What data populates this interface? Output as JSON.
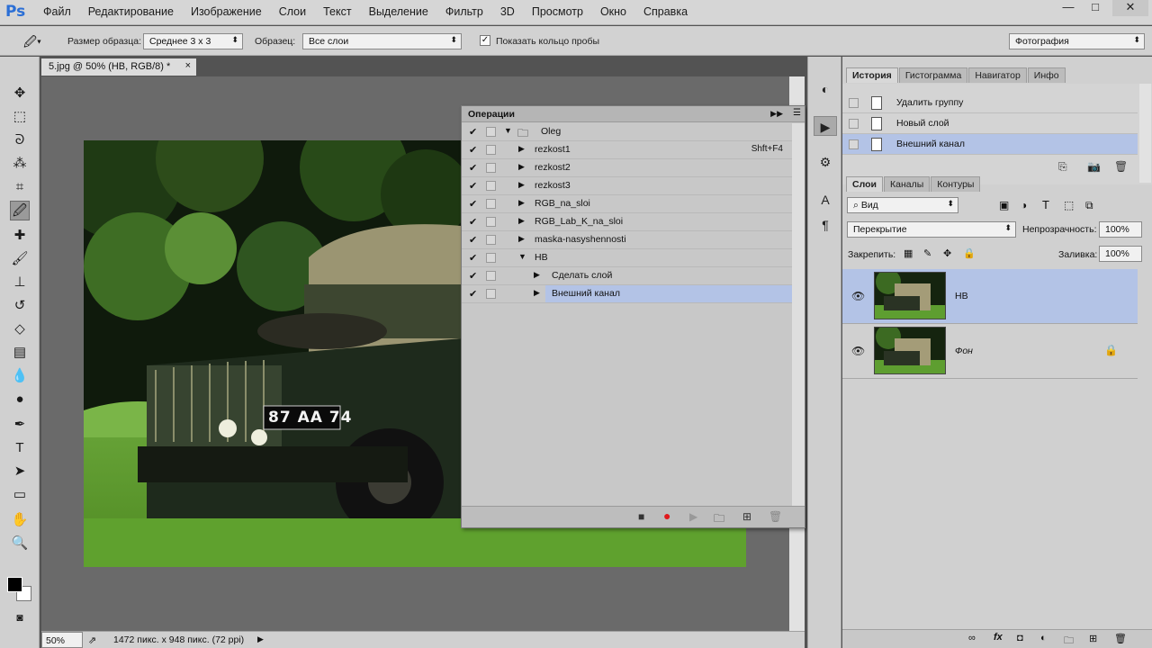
{
  "app": {
    "logo": "Ps"
  },
  "menu": [
    "Файл",
    "Редактирование",
    "Изображение",
    "Слои",
    "Текст",
    "Выделение",
    "Фильтр",
    "3D",
    "Просмотр",
    "Окно",
    "Справка"
  ],
  "window_controls": {
    "minimize": "—",
    "maximize": "□",
    "close": "✕"
  },
  "options": {
    "sample_size_label": "Размер образца:",
    "sample_size_value": "Среднее 3 x 3",
    "sample_label": "Образец:",
    "sample_value": "Все слои",
    "show_ring_label": "Показать кольцо пробы",
    "show_ring_checked": true,
    "workspace": "Фотография"
  },
  "tools": [
    "move-icon",
    "marquee-icon",
    "lasso-icon",
    "quick-select-icon",
    "crop-icon",
    "eyedropper-icon",
    "healing-icon",
    "brush-icon",
    "stamp-icon",
    "history-brush-icon",
    "eraser-icon",
    "gradient-icon",
    "blur-icon",
    "dodge-icon",
    "pen-icon",
    "type-icon",
    "path-select-icon",
    "shape-icon",
    "hand-icon",
    "zoom-icon"
  ],
  "document": {
    "tab_title": "5.jpg @ 50% (HB, RGB/8) *",
    "tab_close": "×",
    "zoom": "50%",
    "info": "1472 пикс. x 948 пикс. (72 ppi)",
    "plate": "87 AA 74"
  },
  "actions_panel": {
    "title": "Операции",
    "items": [
      {
        "name": "Oleg",
        "shortcut": "",
        "level": 0,
        "folder": true,
        "expanded": true,
        "selected": false
      },
      {
        "name": "rezkost1",
        "shortcut": "Shft+F4",
        "level": 1,
        "folder": false,
        "expanded": false,
        "selected": false
      },
      {
        "name": "rezkost2",
        "shortcut": "",
        "level": 1,
        "folder": false,
        "expanded": false,
        "selected": false
      },
      {
        "name": "rezkost3",
        "shortcut": "",
        "level": 1,
        "folder": false,
        "expanded": false,
        "selected": false
      },
      {
        "name": "RGB_na_sloi",
        "shortcut": "",
        "level": 1,
        "folder": false,
        "expanded": false,
        "selected": false
      },
      {
        "name": "RGB_Lab_K_na_sloi",
        "shortcut": "",
        "level": 1,
        "folder": false,
        "expanded": false,
        "selected": false
      },
      {
        "name": "maska-nasyshennosti",
        "shortcut": "",
        "level": 1,
        "folder": false,
        "expanded": false,
        "selected": false
      },
      {
        "name": "HB",
        "shortcut": "",
        "level": 1,
        "folder": false,
        "expanded": true,
        "selected": false
      },
      {
        "name": "Сделать слой",
        "shortcut": "",
        "level": 2,
        "folder": false,
        "expanded": false,
        "selected": false
      },
      {
        "name": "Внешний канал",
        "shortcut": "",
        "level": 2,
        "folder": false,
        "expanded": false,
        "selected": true
      }
    ]
  },
  "history_panel": {
    "tabs": [
      "История",
      "Гистограмма",
      "Навигатор",
      "Инфо"
    ],
    "items": [
      {
        "name": "Удалить группу",
        "selected": false
      },
      {
        "name": "Новый слой",
        "selected": false
      },
      {
        "name": "Внешний канал",
        "selected": true
      }
    ]
  },
  "layers_panel": {
    "tabs": [
      "Слои",
      "Каналы",
      "Контуры"
    ],
    "filter": "Вид",
    "blend_mode": "Перекрытие",
    "opacity_label": "Непрозрачность:",
    "opacity": "100%",
    "lock_label": "Закрепить:",
    "fill_label": "Заливка:",
    "fill": "100%",
    "layers": [
      {
        "name": "HB",
        "italic": false,
        "selected": true,
        "locked": false
      },
      {
        "name": "Фон",
        "italic": true,
        "selected": false,
        "locked": true
      }
    ]
  },
  "colors": {
    "selection": "#b3c3e6",
    "record": "#e0191c",
    "brand": "#2b6fd6"
  }
}
